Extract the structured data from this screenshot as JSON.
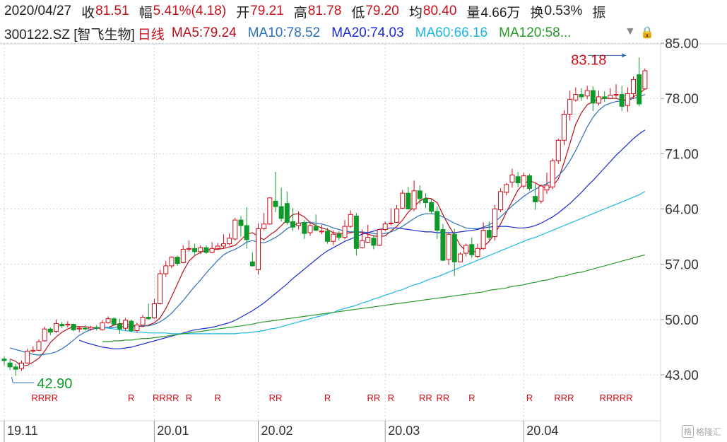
{
  "header": {
    "date": "2020/04/27",
    "close_label": "收",
    "close": "81.51",
    "change_label": "幅",
    "change": "5.41%(4.18)",
    "open_label": "开",
    "open": "79.21",
    "high_label": "高",
    "high": "81.78",
    "low_label": "低",
    "low": "79.20",
    "avg_label": "均",
    "avg": "80.40",
    "volume_label": "量",
    "volume": "4.66万",
    "turnover_label": "换",
    "turnover": "0.53%",
    "amplitude_label": "振"
  },
  "indicators": {
    "code": "300122.SZ [智飞生物]",
    "period": "日线",
    "ma5": "MA5:79.24",
    "ma10": "MA10:78.52",
    "ma20": "MA20:74.03",
    "ma60": "MA60:66.16",
    "ma120": "MA120:58..."
  },
  "colors": {
    "up": "#d20b17",
    "down": "#0e9a2a",
    "ma5": "#b8101a",
    "ma10": "#2b6fb8",
    "ma20": "#1a2bd1",
    "ma60": "#1ab6e0",
    "ma120": "#2a9a2a",
    "grid": "#cfd4dc",
    "axis_text": "#333333"
  },
  "logo": {
    "badge": "格",
    "text": "格隆汇"
  },
  "chart_data": {
    "type": "candlestick",
    "y_ticks": [
      "85.00",
      "78.00",
      "71.00",
      "64.00",
      "57.00",
      "50.00",
      "43.00"
    ],
    "ylim": [
      43,
      85
    ],
    "x_ticks": [
      {
        "label": "19.11",
        "index": 0
      },
      {
        "label": "20.01",
        "index": 26
      },
      {
        "label": "20.02",
        "index": 44
      },
      {
        "label": "20.03",
        "index": 66
      },
      {
        "label": "20.04",
        "index": 90
      }
    ],
    "annotations": [
      {
        "label": "83.18",
        "index": 108,
        "value": 83.18,
        "type": "max"
      },
      {
        "label": "42.90",
        "index": 2,
        "value": 42.9,
        "type": "min"
      }
    ],
    "r_markers": [
      {
        "text": "RRRR",
        "index": 7
      },
      {
        "text": "R",
        "index": 22
      },
      {
        "text": "RRRR",
        "index": 28
      },
      {
        "text": "R",
        "index": 32
      },
      {
        "text": "R",
        "index": 37
      },
      {
        "text": "RR",
        "index": 47
      },
      {
        "text": "R",
        "index": 56
      },
      {
        "text": "RR",
        "index": 64
      },
      {
        "text": "R",
        "index": 67
      },
      {
        "text": "RR",
        "index": 73
      },
      {
        "text": "RR",
        "index": 76
      },
      {
        "text": "R",
        "index": 81
      },
      {
        "text": "R",
        "index": 91
      },
      {
        "text": "RRR",
        "index": 97
      },
      {
        "text": "RRRRR",
        "index": 106
      }
    ],
    "candles": [
      [
        45.0,
        44.8,
        45.3,
        44.2
      ],
      [
        44.5,
        44.0,
        44.9,
        43.6
      ],
      [
        44.0,
        43.7,
        44.4,
        42.9
      ],
      [
        43.8,
        44.5,
        44.8,
        43.5
      ],
      [
        44.5,
        46.0,
        46.3,
        44.4
      ],
      [
        46.0,
        46.1,
        46.6,
        45.8
      ],
      [
        46.1,
        47.2,
        47.5,
        46.0
      ],
      [
        47.3,
        48.8,
        49.1,
        47.2
      ],
      [
        48.8,
        48.4,
        49.0,
        48.0
      ],
      [
        48.5,
        49.5,
        50.0,
        48.3
      ],
      [
        49.4,
        49.2,
        49.7,
        48.9
      ],
      [
        49.4,
        49.4,
        49.8,
        49.0
      ],
      [
        49.4,
        48.7,
        49.5,
        48.5
      ],
      [
        48.8,
        48.9,
        49.1,
        48.4
      ],
      [
        48.9,
        48.8,
        49.3,
        48.6
      ],
      [
        48.8,
        49.0,
        49.2,
        48.6
      ],
      [
        49.0,
        48.9,
        49.3,
        48.6
      ],
      [
        48.7,
        49.6,
        49.9,
        48.6
      ],
      [
        49.6,
        50.1,
        50.4,
        49.5
      ],
      [
        50.1,
        49.4,
        50.3,
        49.2
      ],
      [
        49.4,
        48.8,
        50.1,
        48.2
      ],
      [
        48.9,
        49.9,
        50.2,
        48.6
      ],
      [
        49.8,
        48.6,
        50.0,
        48.4
      ],
      [
        48.6,
        49.3,
        49.6,
        48.3
      ],
      [
        49.3,
        50.3,
        50.6,
        49.2
      ],
      [
        50.3,
        50.1,
        52.0,
        50.0
      ],
      [
        50.2,
        52.0,
        52.6,
        50.1
      ],
      [
        52.0,
        55.8,
        56.3,
        51.9
      ],
      [
        55.8,
        56.8,
        57.4,
        55.4
      ],
      [
        56.8,
        57.9,
        58.0,
        56.5
      ],
      [
        57.9,
        57.1,
        58.1,
        56.8
      ],
      [
        57.2,
        58.9,
        59.4,
        57.1
      ],
      [
        58.9,
        59.0,
        60.0,
        58.6
      ],
      [
        59.0,
        58.6,
        59.6,
        58.2
      ],
      [
        58.6,
        59.1,
        59.4,
        58.3
      ],
      [
        59.1,
        58.5,
        59.4,
        58.3
      ],
      [
        58.5,
        59.0,
        59.8,
        58.4
      ],
      [
        59.0,
        59.3,
        59.7,
        58.8
      ],
      [
        59.3,
        59.6,
        60.8,
        59.0
      ],
      [
        59.6,
        60.3,
        60.9,
        59.4
      ],
      [
        60.2,
        62.6,
        62.9,
        60.0
      ],
      [
        62.6,
        61.9,
        63.1,
        60.5
      ],
      [
        61.9,
        60.1,
        64.2,
        59.0
      ],
      [
        57.3,
        56.8,
        58.5,
        56.7
      ],
      [
        56.3,
        61.5,
        62.2,
        55.7
      ],
      [
        61.5,
        62.1,
        63.5,
        61.3
      ],
      [
        62.1,
        65.4,
        65.5,
        62.0
      ],
      [
        65.0,
        64.3,
        68.7,
        63.6
      ],
      [
        64.3,
        62.8,
        66.7,
        62.4
      ],
      [
        64.7,
        62.3,
        66.2,
        62.0
      ],
      [
        62.4,
        61.7,
        64.1,
        61.2
      ],
      [
        61.9,
        62.2,
        63.7,
        61.4
      ],
      [
        62.3,
        60.9,
        62.6,
        60.2
      ],
      [
        61.0,
        61.9,
        62.4,
        60.6
      ],
      [
        61.8,
        61.3,
        63.3,
        61.2
      ],
      [
        61.1,
        61.2,
        62.0,
        60.8
      ],
      [
        61.2,
        59.9,
        61.6,
        59.6
      ],
      [
        59.9,
        60.8,
        61.3,
        59.4
      ],
      [
        60.8,
        60.4,
        61.2,
        60.0
      ],
      [
        60.4,
        61.8,
        62.6,
        60.2
      ],
      [
        61.8,
        63.3,
        63.8,
        61.6
      ],
      [
        63.1,
        59.0,
        63.5,
        58.1
      ],
      [
        59.1,
        60.0,
        61.4,
        59.0
      ],
      [
        59.8,
        60.4,
        62.0,
        59.7
      ],
      [
        60.3,
        59.4,
        60.7,
        58.9
      ],
      [
        59.4,
        61.4,
        61.5,
        59.3
      ],
      [
        61.4,
        62.1,
        62.4,
        61.2
      ],
      [
        62.2,
        62.2,
        64.1,
        61.9
      ],
      [
        62.3,
        64.0,
        64.5,
        62.3
      ],
      [
        64.1,
        66.0,
        66.4,
        64.0
      ],
      [
        66.0,
        64.0,
        66.8,
        64.0
      ],
      [
        64.0,
        66.3,
        67.6,
        63.7
      ],
      [
        66.3,
        65.3,
        67.0,
        64.6
      ],
      [
        65.3,
        64.8,
        66.0,
        64.1
      ],
      [
        64.8,
        63.7,
        65.3,
        63.4
      ],
      [
        63.7,
        61.3,
        64.3,
        60.2
      ],
      [
        61.4,
        57.5,
        62.1,
        57.4
      ],
      [
        57.6,
        60.8,
        61.0,
        56.9
      ],
      [
        60.8,
        57.3,
        61.5,
        55.5
      ],
      [
        57.3,
        58.3,
        58.5,
        57.4
      ],
      [
        58.4,
        59.4,
        59.6,
        58.0
      ],
      [
        59.5,
        58.2,
        60.4,
        57.8
      ],
      [
        58.0,
        59.0,
        59.6,
        57.8
      ],
      [
        59.0,
        61.3,
        62.3,
        58.8
      ],
      [
        61.3,
        60.4,
        62.4,
        60.0
      ],
      [
        60.5,
        64.0,
        64.5,
        60.0
      ],
      [
        63.9,
        66.2,
        66.6,
        63.6
      ],
      [
        66.1,
        67.1,
        67.3,
        65.7
      ],
      [
        67.4,
        68.3,
        69.1,
        66.7
      ],
      [
        68.1,
        67.3,
        68.7,
        66.8
      ],
      [
        66.9,
        68.2,
        68.6,
        66.6
      ],
      [
        68.2,
        66.6,
        68.4,
        66.3
      ],
      [
        65.6,
        64.9,
        67.2,
        63.9
      ],
      [
        65.0,
        66.9,
        67.1,
        64.7
      ],
      [
        66.4,
        67.0,
        68.6,
        65.9
      ],
      [
        66.8,
        70.1,
        70.4,
        66.5
      ],
      [
        70.1,
        72.7,
        72.9,
        69.7
      ],
      [
        72.7,
        76.0,
        76.5,
        72.1
      ],
      [
        76.0,
        77.9,
        79.0,
        75.2
      ],
      [
        77.8,
        78.5,
        79.4,
        77.6
      ],
      [
        78.5,
        78.2,
        79.3,
        77.7
      ],
      [
        78.3,
        79.0,
        79.6,
        77.9
      ],
      [
        79.0,
        77.4,
        79.5,
        76.4
      ],
      [
        77.4,
        78.2,
        79.0,
        77.1
      ],
      [
        78.2,
        78.0,
        78.9,
        77.6
      ],
      [
        78.0,
        78.4,
        79.3,
        77.9
      ],
      [
        78.4,
        78.5,
        79.8,
        78.1
      ],
      [
        78.5,
        77.0,
        79.6,
        76.4
      ],
      [
        77.1,
        78.6,
        79.4,
        76.3
      ],
      [
        78.6,
        80.4,
        80.8,
        77.9
      ],
      [
        81.0,
        77.3,
        83.2,
        77.0
      ],
      [
        79.2,
        81.5,
        81.8,
        79.2
      ]
    ],
    "ma_series": {
      "MA5": [
        45.0,
        44.7,
        44.1,
        44.2,
        44.6,
        45.1,
        46.0,
        47.1,
        47.8,
        48.4,
        48.8,
        49.1,
        49.1,
        49.1,
        49.0,
        48.9,
        48.9,
        49.0,
        49.3,
        49.5,
        49.4,
        49.3,
        49.2,
        49.1,
        49.3,
        49.6,
        50.2,
        51.4,
        52.9,
        54.5,
        56.1,
        57.4,
        58.1,
        58.5,
        58.8,
        58.9,
        58.9,
        59.0,
        59.2,
        59.4,
        60.1,
        60.8,
        61.0,
        60.5,
        60.1,
        60.7,
        61.2,
        61.9,
        62.6,
        63.3,
        63.4,
        63.0,
        62.3,
        61.9,
        61.6,
        61.4,
        61.0,
        60.9,
        60.9,
        61.0,
        61.1,
        61.0,
        60.8,
        60.6,
        60.5,
        60.6,
        61.2,
        61.8,
        62.6,
        63.6,
        64.3,
        65.0,
        65.4,
        65.3,
        64.8,
        63.3,
        61.9,
        60.7,
        59.4,
        58.7,
        58.6,
        58.6,
        59.2,
        59.9,
        60.9,
        62.1,
        63.6,
        65.0,
        66.4,
        67.2,
        67.6,
        67.3,
        66.9,
        66.6,
        66.9,
        67.8,
        69.9,
        72.3,
        74.7,
        76.2,
        77.2,
        77.6,
        77.9,
        78.0,
        78.0,
        78.0,
        77.8,
        77.8,
        78.2,
        78.6,
        79.2
      ],
      "MA10": [
        46.4,
        46.2,
        46.0,
        45.8,
        45.6,
        45.5,
        45.6,
        45.7,
        45.9,
        46.3,
        46.8,
        47.4,
        48.0,
        48.4,
        48.7,
        48.9,
        49.0,
        49.0,
        49.0,
        49.1,
        49.1,
        49.1,
        49.2,
        49.2,
        49.2,
        49.4,
        49.7,
        50.2,
        50.8,
        51.6,
        52.4,
        53.3,
        54.2,
        55.0,
        55.9,
        56.7,
        57.5,
        58.2,
        58.6,
        58.9,
        59.3,
        59.8,
        60.0,
        59.8,
        59.7,
        60.0,
        60.4,
        60.9,
        61.5,
        61.9,
        62.2,
        62.3,
        62.3,
        62.2,
        62.1,
        61.9,
        61.6,
        61.4,
        61.2,
        61.1,
        61.1,
        61.1,
        61.0,
        60.9,
        60.8,
        60.9,
        61.1,
        61.4,
        61.8,
        62.3,
        62.8,
        63.2,
        63.4,
        63.4,
        63.3,
        63.0,
        62.6,
        62.2,
        61.9,
        61.6,
        61.5,
        61.5,
        61.7,
        62.0,
        62.4,
        63.0,
        63.7,
        64.4,
        65.0,
        65.6,
        66.1,
        66.5,
        66.9,
        67.2,
        67.6,
        68.2,
        69.0,
        70.1,
        71.4,
        72.9,
        74.4,
        75.6,
        76.5,
        77.1,
        77.4,
        77.6,
        77.7,
        77.8,
        78.0,
        78.2,
        78.5
      ],
      "MA20": [
        47.4,
        47.1,
        46.9,
        46.7,
        46.5,
        46.4,
        46.3,
        46.3,
        46.4,
        46.5,
        46.7,
        46.9,
        47.1,
        47.3,
        47.5,
        47.7,
        47.9,
        48.1,
        48.3,
        48.5,
        48.7,
        48.8,
        48.9,
        49.0,
        49.2,
        49.4,
        49.6,
        49.9,
        50.3,
        50.7,
        51.1,
        51.6,
        52.1,
        52.7,
        53.3,
        53.9,
        54.5,
        55.2,
        55.8,
        56.4,
        57.0,
        57.6,
        58.2,
        58.7,
        59.1,
        59.5,
        59.9,
        60.2,
        60.5,
        60.8,
        61.0,
        61.2,
        61.4,
        61.5,
        61.6,
        61.6,
        61.5,
        61.4,
        61.3,
        61.2,
        61.1,
        61.1,
        61.0,
        61.0,
        61.0,
        61.0,
        61.1,
        61.2,
        61.3,
        61.4,
        61.6,
        61.7,
        61.8,
        61.8,
        61.8,
        61.7,
        61.6,
        61.6,
        61.7,
        61.9,
        62.2,
        62.6,
        63.0,
        63.5,
        64.1,
        64.7,
        65.4,
        66.1,
        66.9,
        67.6,
        68.4,
        69.2,
        70.0,
        70.8,
        71.5,
        72.2,
        72.9,
        73.5,
        74.0
      ],
      "MA60": [
        49.0,
        48.9,
        48.8,
        48.7,
        48.6,
        48.5,
        48.4,
        48.4,
        48.3,
        48.3,
        48.3,
        48.3,
        48.2,
        48.2,
        48.2,
        48.2,
        48.2,
        48.2,
        48.2,
        48.2,
        48.2,
        48.2,
        48.2,
        48.2,
        48.3,
        48.3,
        48.4,
        48.5,
        48.6,
        48.8,
        48.9,
        49.1,
        49.3,
        49.5,
        49.7,
        49.9,
        50.1,
        50.3,
        50.5,
        50.7,
        50.9,
        51.2,
        51.4,
        51.6,
        51.8,
        52.1,
        52.3,
        52.6,
        52.8,
        53.1,
        53.3,
        53.6,
        53.8,
        54.1,
        54.4,
        54.6,
        54.9,
        55.2,
        55.4,
        55.7,
        56.0,
        56.3,
        56.6,
        56.9,
        57.2,
        57.5,
        57.8,
        58.1,
        58.4,
        58.7,
        59.0,
        59.3,
        59.6,
        59.9,
        60.2,
        60.4,
        60.7,
        61.0,
        61.3,
        61.6,
        61.9,
        62.2,
        62.5,
        62.8,
        63.1,
        63.4,
        63.7,
        64.0,
        64.3,
        64.6,
        64.9,
        65.2,
        65.5,
        65.8,
        66.2
      ],
      "MA120": [
        47.2,
        47.2,
        47.3,
        47.3,
        47.4,
        47.4,
        47.5,
        47.6,
        47.6,
        47.7,
        47.8,
        47.9,
        48.0,
        48.1,
        48.2,
        48.3,
        48.4,
        48.5,
        48.6,
        48.7,
        48.8,
        48.9,
        49.0,
        49.1,
        49.2,
        49.3,
        49.4,
        49.6,
        49.7,
        49.8,
        49.9,
        50.0,
        50.1,
        50.2,
        50.3,
        50.4,
        50.5,
        50.6,
        50.7,
        50.8,
        50.9,
        51.0,
        51.1,
        51.2,
        51.3,
        51.4,
        51.5,
        51.6,
        51.7,
        51.8,
        51.9,
        52.0,
        52.1,
        52.2,
        52.3,
        52.4,
        52.5,
        52.6,
        52.7,
        52.8,
        52.9,
        53.0,
        53.1,
        53.2,
        53.3,
        53.4,
        53.5,
        53.7,
        53.8,
        53.9,
        54.0,
        54.2,
        54.3,
        54.4,
        54.6,
        54.7,
        54.9,
        55.0,
        55.2,
        55.4,
        55.5,
        55.7,
        55.9,
        56.0,
        56.2,
        56.4,
        56.6,
        56.8,
        57.0,
        57.2,
        57.4,
        57.6,
        57.8,
        58.0,
        58.2
      ]
    }
  }
}
